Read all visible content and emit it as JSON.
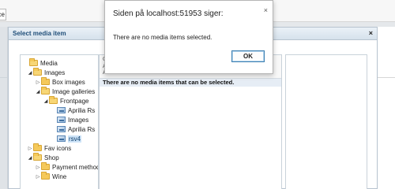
{
  "background": {
    "button_label": "ce"
  },
  "media_dialog": {
    "title": "Select media item",
    "close_label": "×",
    "mid_header": [
      "O",
      "Al",
      "Al"
    ],
    "empty_message": "There are no media items that can be selected.",
    "tree": [
      {
        "label": "Media",
        "type": "folder",
        "toggle": "",
        "level": 0
      },
      {
        "label": "Images",
        "type": "folder",
        "toggle": "◢",
        "level": 1
      },
      {
        "label": "Box images",
        "type": "folder",
        "toggle": "▷",
        "level": 2
      },
      {
        "label": "Image galleries",
        "type": "folder",
        "toggle": "◢",
        "level": 2
      },
      {
        "label": "Frontpage",
        "type": "folder",
        "toggle": "◢",
        "level": 3
      },
      {
        "label": "Aprilia Rs",
        "type": "image",
        "toggle": "",
        "level": 4
      },
      {
        "label": "Images",
        "type": "image",
        "toggle": "",
        "level": 4
      },
      {
        "label": "Aprilia Rs",
        "type": "image",
        "toggle": "",
        "level": 4
      },
      {
        "label": "rsv4",
        "type": "image",
        "toggle": "",
        "level": 4,
        "selected": true
      },
      {
        "label": "Fav icons",
        "type": "folder",
        "toggle": "▷",
        "level": 1
      },
      {
        "label": "Shop",
        "type": "folder",
        "toggle": "◢",
        "level": 1
      },
      {
        "label": "Payment method",
        "type": "folder",
        "toggle": "▷",
        "level": 2
      },
      {
        "label": "Wine",
        "type": "folder",
        "toggle": "▷",
        "level": 2
      }
    ]
  },
  "alert": {
    "title": "Siden på localhost:51953 siger:",
    "close_label": "×",
    "message": "There are no media items selected.",
    "ok_label": "OK"
  }
}
